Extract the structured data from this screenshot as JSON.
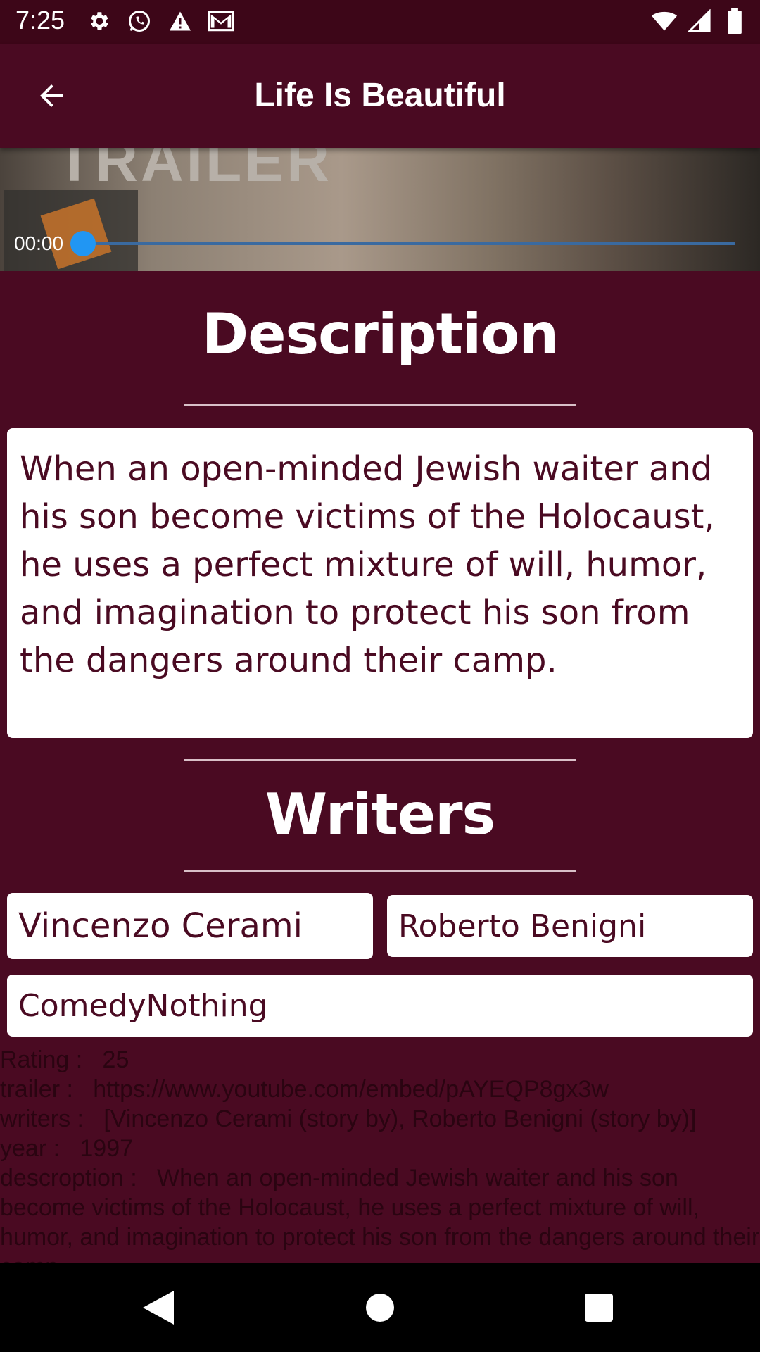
{
  "status_bar": {
    "time": "7:25",
    "left_icons": [
      "gear-icon",
      "whatsapp-icon",
      "warning-icon",
      "gmail-icon"
    ],
    "right_icons": [
      "wifi-icon",
      "signal-icon",
      "battery-icon"
    ]
  },
  "app_bar": {
    "title": "Life Is Beautiful"
  },
  "video": {
    "overlay_text": "TRAILER",
    "current_time": "00:00",
    "progress": 0
  },
  "description_section": {
    "title": "Description",
    "text": "When an open-minded Jewish waiter and his son become victims of the Holocaust, he uses a perfect mixture of will, humor, and imagination to protect his son from the dangers around their camp."
  },
  "writers_section": {
    "title": "Writers",
    "writers": [
      "Vincenzo Cerami",
      "Roberto Benigni"
    ],
    "genre": "ComedyNothing"
  },
  "info": {
    "rating_label": "Rating :",
    "rating_value": "25",
    "trailer_label": "trailer :",
    "trailer_value": "https://www.youtube.com/embed/pAYEQP8gx3w",
    "writers_label": "writers :",
    "writers_value": "[Vincenzo Cerami (story by), Roberto Benigni (story by)]",
    "year_label": "year :",
    "year_value": "1997",
    "description_label": "descroption :",
    "description_value": "When an open-minded Jewish waiter and his son become victims of the Holocaust, he uses a perfect mixture of will, humor, and imagination to protect his son from the dangers around their camp."
  },
  "colors": {
    "background": "#4a0a22",
    "accent": "#2196f3",
    "card": "#ffffff"
  }
}
